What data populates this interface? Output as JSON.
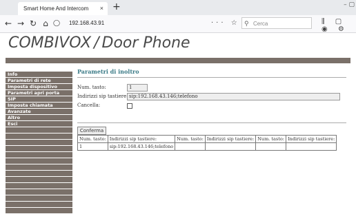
{
  "browser": {
    "tab_title": "Smart Home And Intercom System",
    "tab_close": "×",
    "new_tab": "+",
    "window_controls": "–  ▢",
    "url": "192.168.43.91",
    "search_placeholder": "Cerca",
    "page_action_icons": "··· ☆",
    "toolbar_icons": "⫼ ▢ ◉ ⚙"
  },
  "brand": {
    "company": "COMBIVOX",
    "separator": "/",
    "product": "Door Phone"
  },
  "sidebar": {
    "items": [
      {
        "label": "Info"
      },
      {
        "label": "Parametri di rete"
      },
      {
        "label": "Imposta dispositivo"
      },
      {
        "label": "Parametri apri porta"
      },
      {
        "label": "SIP"
      },
      {
        "label": "Imposta chiamata"
      },
      {
        "label": "Avanzate"
      },
      {
        "label": "Altro"
      },
      {
        "label": "Esci"
      }
    ]
  },
  "main": {
    "title": "Parametri di inoltro",
    "fields": {
      "num_tasto_label": "Num. tasto:",
      "num_tasto_value": "1",
      "indirizzi_label": "Indirizzi sip tastiere:",
      "indirizzi_value": "sip:192.168.43.146;telefono",
      "cancella_label": "Cancella:"
    },
    "confirm_button": "Conferma",
    "table": {
      "headers": [
        "Num. tasto:",
        "Indirizzi sip tastiere:",
        "Num. tasto:",
        "Indirizzi sip tastiere:",
        "Num. tasto:",
        "Indirizzi sip tastiere:"
      ],
      "rows": [
        [
          "1",
          "sip:192.168.43.146;telefono",
          "",
          "",
          "",
          ""
        ]
      ]
    }
  }
}
